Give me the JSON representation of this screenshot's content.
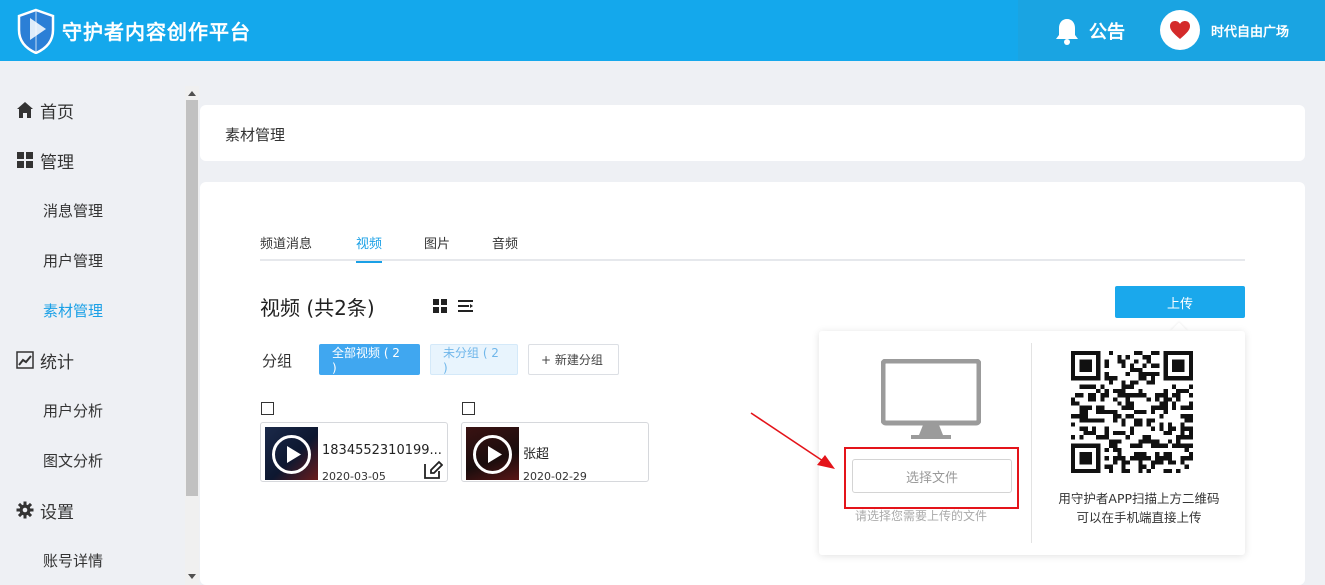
{
  "header": {
    "app_title": "守护者内容创作平台",
    "notice_label": "公告",
    "user_name": "时代自由广场",
    "brand_color": "#14a8ec"
  },
  "sidebar": {
    "items": [
      {
        "label": "首页",
        "icon": "home-icon",
        "level": "top"
      },
      {
        "label": "管理",
        "icon": "grid-icon",
        "level": "top"
      },
      {
        "label": "消息管理",
        "level": "sub"
      },
      {
        "label": "用户管理",
        "level": "sub"
      },
      {
        "label": "素材管理",
        "level": "sub",
        "active": true
      },
      {
        "label": "统计",
        "icon": "chart-icon",
        "level": "top"
      },
      {
        "label": "用户分析",
        "level": "sub"
      },
      {
        "label": "图文分析",
        "level": "sub"
      },
      {
        "label": "设置",
        "icon": "gear-icon",
        "level": "top"
      },
      {
        "label": "账号详情",
        "level": "sub"
      }
    ],
    "active_color": "#1aa0e6"
  },
  "page": {
    "title": "素材管理"
  },
  "tabs": [
    {
      "label": "频道消息"
    },
    {
      "label": "视频",
      "active": true
    },
    {
      "label": "图片"
    },
    {
      "label": "音频"
    }
  ],
  "section": {
    "title": "视频 (共2条)",
    "upload_label": "上传"
  },
  "groups": {
    "label": "分组",
    "all": "全部视频 ( 2 )",
    "ungrouped": "未分组 ( 2 )",
    "new_group": "+ 新建分组"
  },
  "media": [
    {
      "name": "1834552310199...",
      "date": "2020-03-05"
    },
    {
      "name": "张超",
      "date": "2020-02-29"
    }
  ],
  "upload_popup": {
    "select_file": "选择文件",
    "select_hint": "请选择您需要上传的文件",
    "qr_hint_line1": "用守护者APP扫描上方二维码",
    "qr_hint_line2": "可以在手机端直接上传"
  }
}
